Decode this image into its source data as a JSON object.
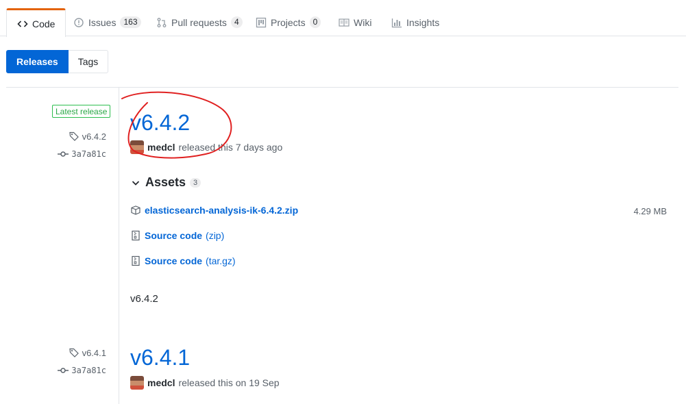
{
  "reponav": {
    "code_label": "Code",
    "issues_label": "Issues",
    "issues_count": "163",
    "pulls_label": "Pull requests",
    "pulls_count": "4",
    "projects_label": "Projects",
    "projects_count": "0",
    "wiki_label": "Wiki",
    "insights_label": "Insights"
  },
  "subnav": {
    "releases_label": "Releases",
    "tags_label": "Tags"
  },
  "releases": [
    {
      "latest_label": "Latest release",
      "tag": "v6.4.2",
      "commit": "3a7a81c",
      "title": "v6.4.2",
      "author": "medcl",
      "released_text": "released this 7 days ago",
      "assets_title": "Assets",
      "assets_count": "3",
      "assets": [
        {
          "name": "elasticsearch-analysis-ik-6.4.2.zip",
          "size": "4.29 MB"
        },
        {
          "name": "Source code",
          "ext": "(zip)"
        },
        {
          "name": "Source code",
          "ext": "(tar.gz)"
        }
      ],
      "body": "v6.4.2"
    },
    {
      "tag": "v6.4.1",
      "commit": "3a7a81c",
      "title": "v6.4.1",
      "author": "medcl",
      "released_text": "released this on 19 Sep"
    }
  ],
  "colors": {
    "accent": "#0366d6",
    "nav_selected": "#e36209",
    "latest_green": "#28a745",
    "annotation_red": "#e02020"
  }
}
